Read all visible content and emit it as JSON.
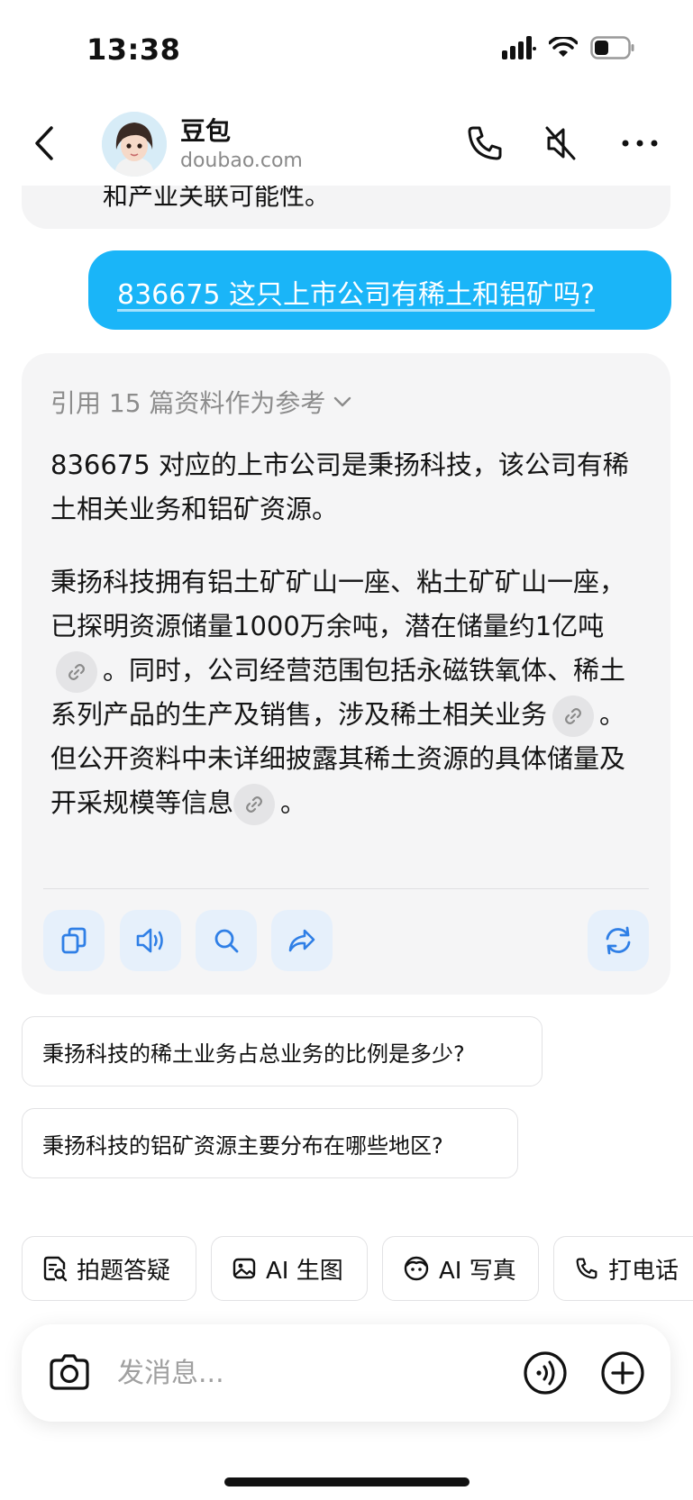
{
  "status_bar": {
    "time": "13:38"
  },
  "header": {
    "name": "豆包",
    "domain": "doubao.com"
  },
  "previous_message": {
    "text": "和产业关联可能性。"
  },
  "user_message": {
    "text": "836675 这只上市公司有稀土和铝矿吗?"
  },
  "answer": {
    "references": "引用 15 篇资料作为参考",
    "paragraph1": "836675 对应的上市公司是秉扬科技，该公司有稀土相关业务和铝矿资源。",
    "p2_seg1": "秉扬科技拥有铝土矿矿山一座、粘土矿矿山一座，已探明资源储量1000万余吨，潜在储量约1亿吨",
    "p2_seg2": "。同时，公司经营范围包括永磁铁氧体、稀土系列产品的生产及销售，涉及稀土相关业务",
    "p2_seg3": "。但公开资料中未详细披露其稀土资源的具体储量及开采规模等信息",
    "p2_seg4": "。"
  },
  "suggestions": [
    "秉扬科技的稀土业务占总业务的比例是多少?",
    "秉扬科技的铝矿资源主要分布在哪些地区?"
  ],
  "quick_actions": [
    {
      "label": "拍题答疑",
      "icon": "photo-question-icon"
    },
    {
      "label": "AI 生图",
      "icon": "image-icon"
    },
    {
      "label": "AI 写真",
      "icon": "face-icon"
    },
    {
      "label": "打电话",
      "icon": "phone-icon"
    }
  ],
  "input": {
    "placeholder": "发消息..."
  },
  "colors": {
    "accent": "#1ab5f8",
    "action_bg": "#e6f0fb",
    "action_icon": "#2f7fe6"
  }
}
